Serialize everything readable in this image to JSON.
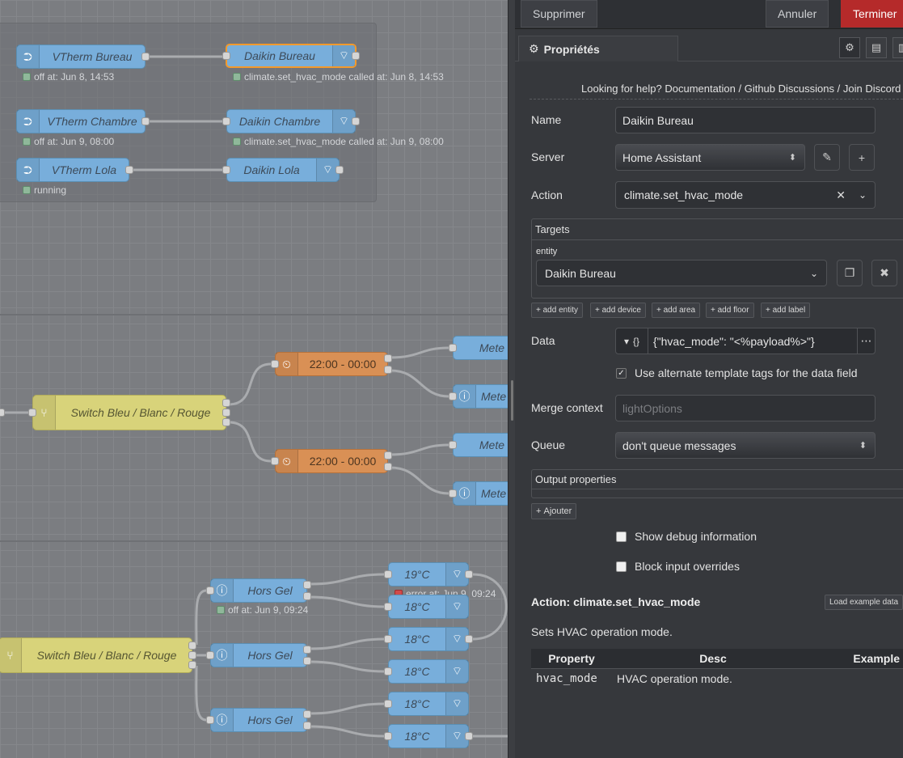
{
  "canvas": {
    "group1": [
      {
        "label": "VTherm Bureau",
        "status": "off at: Jun 8, 14:53"
      },
      {
        "label": "VTherm Chambre",
        "status": "off at: Jun 9, 08:00"
      },
      {
        "label": "VTherm Lola",
        "status": "running"
      }
    ],
    "group1_actions": [
      {
        "label": "Daikin Bureau",
        "status": "climate.set_hvac_mode called at: Jun 8, 14:53"
      },
      {
        "label": "Daikin Chambre",
        "status": "climate.set_hvac_mode called at: Jun 9, 08:00"
      },
      {
        "label": "Daikin Lola",
        "status": ""
      }
    ],
    "switch1_label": "Switch Bleu / Blanc / Rouge",
    "time_nodes": [
      "22:00 - 00:00",
      "22:00 - 00:00"
    ],
    "meteo_nodes": [
      "Mete",
      "Mete",
      "Mete",
      "Mete"
    ],
    "switch2_label": "Switch Bleu / Blanc / Rouge",
    "hors_gel": [
      {
        "label": "Hors Gel",
        "status": "off at: Jun 9, 09:24"
      },
      {
        "label": "Hors Gel",
        "status": ""
      },
      {
        "label": "Hors Gel",
        "status": ""
      }
    ],
    "temp_nodes": [
      "19°C",
      "18°C",
      "18°C",
      "18°C",
      "18°C",
      "18°C"
    ],
    "temp_error_status": "error at: Jun 9, 09:24"
  },
  "toolbar": {
    "delete_label": "Supprimer",
    "cancel_label": "Annuler",
    "done_label": "Terminer"
  },
  "tab": {
    "properties_label": "Propriétés"
  },
  "help": {
    "prefix": "Looking for help?",
    "documentation": "Documentation",
    "sep": "/",
    "github": "Github Discussions",
    "discord": "Join Discord"
  },
  "form": {
    "name_label": "Name",
    "name_value": "Daikin Bureau",
    "server_label": "Server",
    "server_value": "Home Assistant",
    "action_label": "Action",
    "action_value": "climate.set_hvac_mode",
    "targets_label": "Targets",
    "entity_label": "entity",
    "entity_value": "Daikin Bureau",
    "add_buttons": [
      "add entity",
      "add device",
      "add area",
      "add floor",
      "add label"
    ],
    "data_label": "Data",
    "data_type": "{}",
    "data_value": "{\"hvac_mode\":  \"<%payload%>\"}",
    "alt_tags_label": "Use alternate template tags for the data field",
    "merge_label": "Merge context",
    "merge_placeholder": "lightOptions",
    "queue_label": "Queue",
    "queue_value": "don't queue messages",
    "output_label": "Output properties",
    "add_output": "Ajouter",
    "debug_label": "Show debug information",
    "block_label": "Block input overrides"
  },
  "doc": {
    "title": "Action: climate.set_hvac_mode",
    "load_example": "Load example data",
    "description": "Sets HVAC operation mode.",
    "columns": [
      "Property",
      "Desc",
      "Example"
    ],
    "rows": [
      {
        "property": "hvac_mode",
        "desc": "HVAC operation mode.",
        "example": ""
      }
    ]
  }
}
